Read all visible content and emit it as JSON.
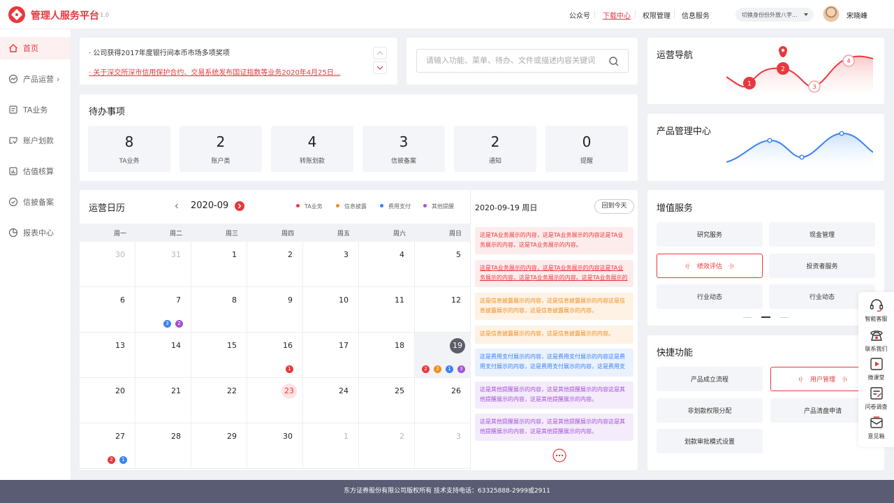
{
  "header": {
    "brand": "管理人服务平台",
    "version": "v 1.0",
    "nav": [
      "公众号",
      "下载中心",
      "权限管理",
      "信息服务"
    ],
    "active_nav": "下载中心",
    "identity_select": "切换身份份外放八字...",
    "username": "宋晓峰"
  },
  "sidebar": {
    "items": [
      {
        "label": "首页",
        "icon": "home-icon",
        "active": true
      },
      {
        "label": "产品运营",
        "icon": "trend-icon",
        "has_arrow": true
      },
      {
        "label": "TA业务",
        "icon": "document-icon"
      },
      {
        "label": "账户划款",
        "icon": "transfer-icon"
      },
      {
        "label": "估值核算",
        "icon": "bar-chart-icon"
      },
      {
        "label": "信披备案",
        "icon": "check-circle-icon"
      },
      {
        "label": "报表中心",
        "icon": "pie-chart-icon"
      }
    ]
  },
  "news": [
    "· 公司获得2017年度银行间本币市场多项奖项",
    "· 关于深交所深市信用保护合约、交易系统发布国证指数等业务2020年4月25日..."
  ],
  "search": {
    "placeholder": "请输入功能、菜单、待办、文件或描述内容关键词"
  },
  "todo": {
    "title": "待办事项",
    "items": [
      {
        "count": "8",
        "label": "TA业务"
      },
      {
        "count": "2",
        "label": "账户类"
      },
      {
        "count": "4",
        "label": "转账划款"
      },
      {
        "count": "3",
        "label": "信披备案"
      },
      {
        "count": "2",
        "label": "通知"
      },
      {
        "count": "0",
        "label": "提醒"
      }
    ]
  },
  "calendar": {
    "title": "运营日历",
    "month": "2020-09",
    "legend": [
      {
        "label": "TA业务",
        "color": "#e8383d"
      },
      {
        "label": "信息披露",
        "color": "#f08c1c"
      },
      {
        "label": "费用支付",
        "color": "#3b82f0"
      },
      {
        "label": "其他提醒",
        "color": "#a352d6"
      }
    ],
    "weekdays": [
      "周一",
      "周二",
      "周三",
      "周四",
      "周五",
      "周六",
      "周日"
    ],
    "weeks": [
      [
        {
          "d": "30",
          "other": true
        },
        {
          "d": "31",
          "other": true
        },
        {
          "d": "1"
        },
        {
          "d": "2"
        },
        {
          "d": "3"
        },
        {
          "d": "4"
        },
        {
          "d": "5"
        }
      ],
      [
        {
          "d": "6"
        },
        {
          "d": "7",
          "badges": [
            {
              "n": "3",
              "c": "#3b82f0"
            },
            {
              "n": "2",
              "c": "#a352d6"
            }
          ]
        },
        {
          "d": "8"
        },
        {
          "d": "9"
        },
        {
          "d": "10"
        },
        {
          "d": "11"
        },
        {
          "d": "12"
        }
      ],
      [
        {
          "d": "13"
        },
        {
          "d": "14"
        },
        {
          "d": "15"
        },
        {
          "d": "16",
          "badges": [
            {
              "n": "1",
              "c": "#e8383d"
            }
          ]
        },
        {
          "d": "17"
        },
        {
          "d": "18"
        },
        {
          "d": "19",
          "selected": true,
          "badges": [
            {
              "n": "2",
              "c": "#e8383d"
            },
            {
              "n": "2",
              "c": "#f08c1c"
            },
            {
              "n": "1",
              "c": "#3b82f0"
            },
            {
              "n": "3",
              "c": "#a352d6"
            }
          ]
        }
      ],
      [
        {
          "d": "20"
        },
        {
          "d": "21"
        },
        {
          "d": "22"
        },
        {
          "d": "23",
          "today": true
        },
        {
          "d": "24"
        },
        {
          "d": "25"
        },
        {
          "d": "26"
        }
      ],
      [
        {
          "d": "27",
          "badges": [
            {
              "n": "2",
              "c": "#e8383d"
            },
            {
              "n": "1",
              "c": "#3b82f0"
            }
          ]
        },
        {
          "d": "28"
        },
        {
          "d": "29"
        },
        {
          "d": "30"
        },
        {
          "d": "1",
          "other": true
        },
        {
          "d": "2",
          "other": true
        },
        {
          "d": "3",
          "other": true
        }
      ]
    ]
  },
  "day_panel": {
    "date": "2020-09-19 周日",
    "back_today": "回到今天",
    "events": [
      {
        "type": "red",
        "text": "这是TA业务展示的内容，这是TA业务展示的内容这是TA业务展示的内容，这是TA业务展示的内容。"
      },
      {
        "type": "red",
        "underline": true,
        "text": "这是TA业务展示的内容，这是TA业务展示的内容这是TA业务展示的内容，这是TA业务展示的内容。这是TA业务展示的内容。"
      },
      {
        "type": "orange",
        "text": "这是信息披露展示的内容，这是信息披露展示的内容这是信息披露展示的内容，这是信息披露展示的内容。"
      },
      {
        "type": "orange",
        "text": "这是信息披露展示的内容，这是信息披露展示的内容。"
      },
      {
        "type": "blue",
        "text": "这是费用支付展示的内容，这是费用支付展示的内容这是费用支付展示的内容，这是费用支付展示的内容，这是费用支付展示的内容。"
      },
      {
        "type": "purple",
        "text": "这是其他提醒展示的内容，这是其他提醒展示的内容这是其他提醒展示的内容，这是其他提醒展示的内容。"
      },
      {
        "type": "purple",
        "text": "这是其他提醒展示的内容，这是其他提醒展示的内容这是其他提醒展示的内容，这是其他提醒展示的内容。"
      }
    ]
  },
  "ops_nav": {
    "title": "运营导航",
    "markers": [
      "1",
      "2",
      "3",
      "4"
    ]
  },
  "product_center": {
    "title": "产品管理中心"
  },
  "value_services": {
    "title": "增值服务",
    "items": [
      "研究服务",
      "现金管理",
      "绩效评估",
      "投资者服务",
      "行业动态",
      "行业动态"
    ],
    "selected": "绩效评估"
  },
  "quick": {
    "title": "快捷功能",
    "items": [
      "产品成立流程",
      "用户管理",
      "非划款权限分配",
      "产品清盘申请",
      "划款审批模式设置"
    ],
    "selected": "用户管理"
  },
  "float_bar": [
    {
      "label": "智能客服",
      "icon": "headset-icon"
    },
    {
      "label": "联系我们",
      "icon": "phone-icon"
    },
    {
      "label": "微课堂",
      "icon": "video-icon"
    },
    {
      "label": "问卷调查",
      "icon": "survey-icon"
    },
    {
      "label": "意见箱",
      "icon": "mailbox-icon"
    }
  ],
  "footer": "东方证券股份有限公司版权所有 技术支持电话：63325888-2999或2911",
  "colors": {
    "accent": "#e8383d",
    "footer": "#595c72",
    "bg": "#f0f1f5"
  }
}
